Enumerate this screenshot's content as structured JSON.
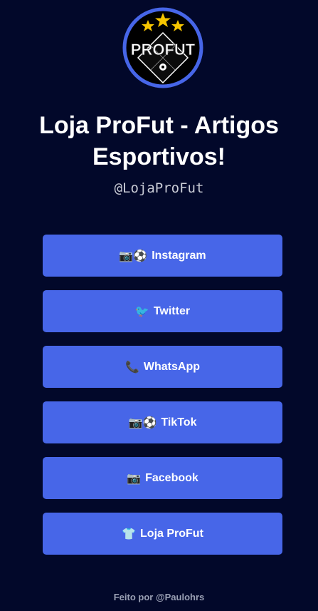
{
  "logo": {
    "text": "PROFUT",
    "ring_color": "#4766e8",
    "star_color": "#f7c600"
  },
  "title": "Loja ProFut - Artigos Esportivos!",
  "handle": "@LojaProFut",
  "links": [
    {
      "icon": "📷⚽",
      "label": "Instagram",
      "icon_name": "camera-soccer-icon"
    },
    {
      "icon": "🐦",
      "label": "Twitter",
      "icon_name": "bird-icon"
    },
    {
      "icon": "📞",
      "label": "WhatsApp",
      "icon_name": "phone-icon"
    },
    {
      "icon": "📷⚽",
      "label": "TikTok",
      "icon_name": "camera-soccer-icon"
    },
    {
      "icon": "📷",
      "label": "Facebook",
      "icon_name": "camera-icon"
    },
    {
      "icon": "👕",
      "label": "Loja ProFut",
      "icon_name": "shirt-icon"
    }
  ],
  "footer": "Feito por @Paulohrs",
  "colors": {
    "background": "#02082a",
    "button": "#4766e8",
    "handle_text": "#c9ccd6",
    "footer_text": "#9aa0b4"
  }
}
